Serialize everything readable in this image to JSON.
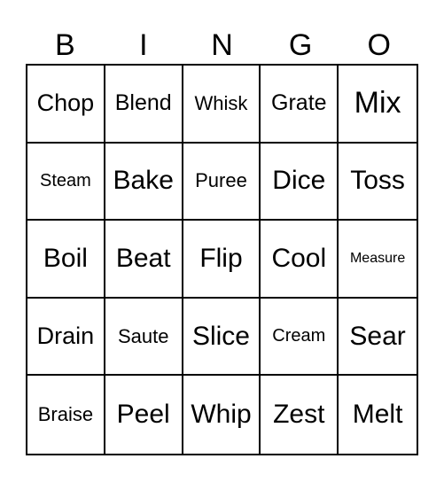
{
  "header": [
    "B",
    "I",
    "N",
    "G",
    "O"
  ],
  "cells": [
    {
      "text": "Chop",
      "size": "s3"
    },
    {
      "text": "Blend",
      "size": "s4"
    },
    {
      "text": "Whisk",
      "size": "s5"
    },
    {
      "text": "Grate",
      "size": "s4"
    },
    {
      "text": "Mix",
      "size": "s1"
    },
    {
      "text": "Steam",
      "size": "s6"
    },
    {
      "text": "Bake",
      "size": "s2"
    },
    {
      "text": "Puree",
      "size": "s5"
    },
    {
      "text": "Dice",
      "size": "s2"
    },
    {
      "text": "Toss",
      "size": "s2"
    },
    {
      "text": "Boil",
      "size": "s2"
    },
    {
      "text": "Beat",
      "size": "s2"
    },
    {
      "text": "Flip",
      "size": "s2"
    },
    {
      "text": "Cool",
      "size": "s2"
    },
    {
      "text": "Measure",
      "size": "s7"
    },
    {
      "text": "Drain",
      "size": "s3"
    },
    {
      "text": "Saute",
      "size": "s5"
    },
    {
      "text": "Slice",
      "size": "s2"
    },
    {
      "text": "Cream",
      "size": "s6"
    },
    {
      "text": "Sear",
      "size": "s2"
    },
    {
      "text": "Braise",
      "size": "s5"
    },
    {
      "text": "Peel",
      "size": "s2"
    },
    {
      "text": "Whip",
      "size": "s2"
    },
    {
      "text": "Zest",
      "size": "s2"
    },
    {
      "text": "Melt",
      "size": "s2"
    }
  ]
}
